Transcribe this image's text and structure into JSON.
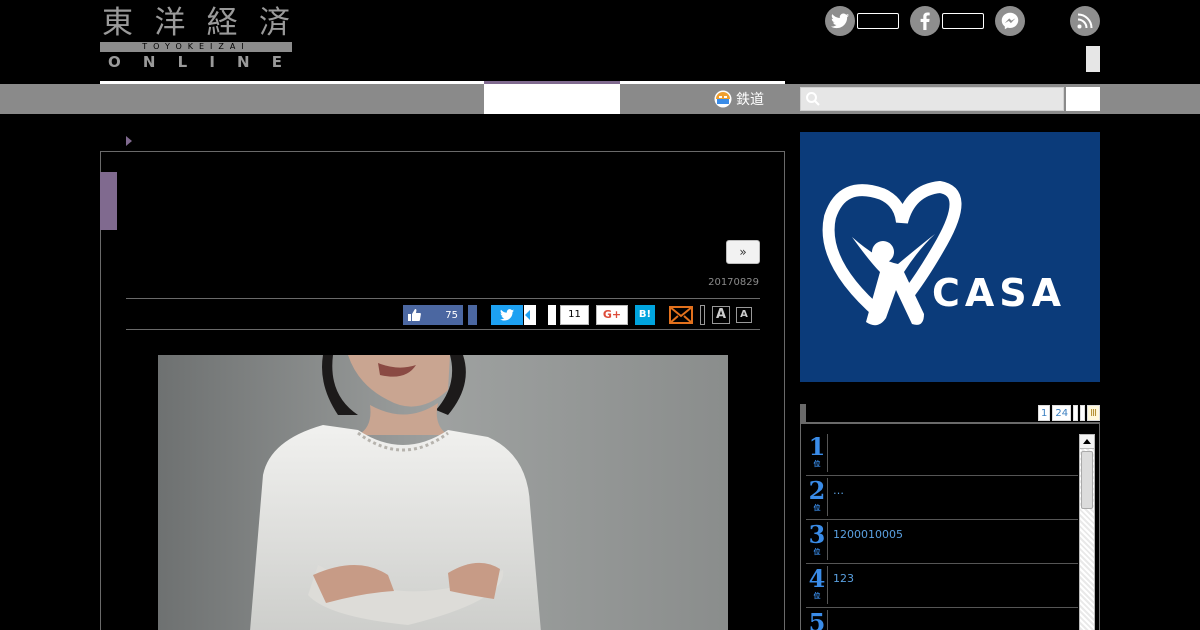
{
  "header": {
    "logo_kanji": [
      "東",
      "洋",
      "経",
      "済"
    ],
    "logo_romaji": "TOYOKEIZAI",
    "logo_online": [
      "O",
      "N",
      "L",
      "I",
      "N",
      "E"
    ]
  },
  "social_icons": {
    "twitter": "twitter-bird-icon",
    "facebook": "facebook-f-icon",
    "messenger": "messenger-icon",
    "rss": "rss-icon"
  },
  "nav": {
    "rail_label": "鉄道",
    "rail_icon": "train-icon",
    "search": {
      "placeholder": "",
      "icon": "search-icon"
    }
  },
  "article": {
    "next_label": "»",
    "date": "20170829",
    "share": {
      "like_count": "75",
      "pocket_count": "11",
      "gplus_label": "G+",
      "hatena_label": "B!",
      "font_large_label": "A",
      "font_small_label": "A"
    }
  },
  "sidebar": {
    "ad": {
      "brand": "CASA",
      "registered": "®",
      "bg_color": "#0b3b7a"
    },
    "ranking": {
      "tabs": [
        "1",
        "24"
      ],
      "tab_last": "Ⅲ",
      "rank_suffix": "位",
      "items": [
        {
          "rank": "1",
          "text": ""
        },
        {
          "rank": "2",
          "text": "…"
        },
        {
          "rank": "3",
          "text": "1200010005"
        },
        {
          "rank": "4",
          "text": "123"
        },
        {
          "rank": "5",
          "text": ""
        }
      ]
    }
  },
  "colors": {
    "accent_purple": "#806a8f",
    "nav_gray": "#8a8a8a",
    "rank_blue": "#3a8ce8"
  }
}
